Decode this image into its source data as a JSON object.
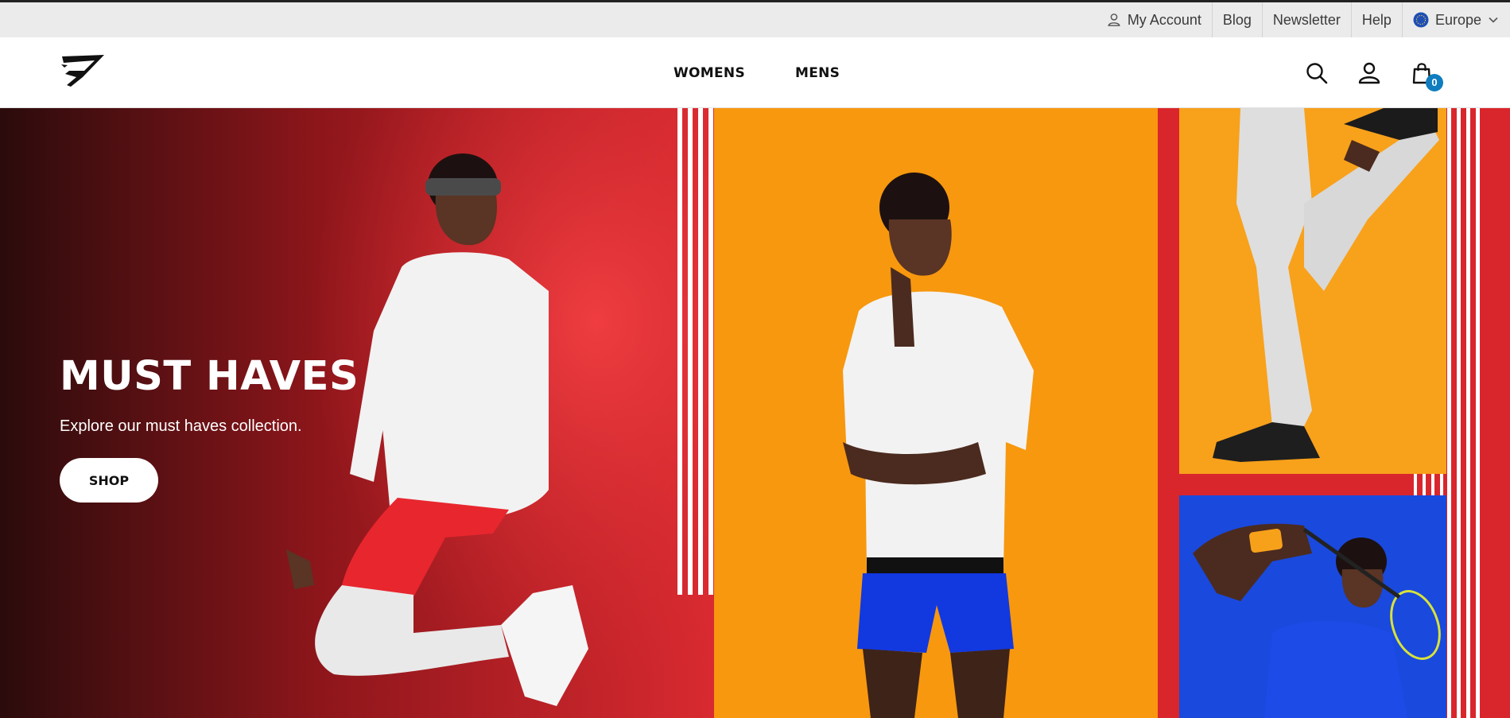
{
  "utility_bar": {
    "my_account": "My Account",
    "blog": "Blog",
    "newsletter": "Newsletter",
    "help": "Help",
    "region": "Europe"
  },
  "header": {
    "nav": [
      "WOMENS",
      "MENS"
    ],
    "cart_count": "0",
    "icons": [
      "search-icon",
      "user-icon",
      "shopping-bag-icon"
    ]
  },
  "hero": {
    "title": "MUST HAVES",
    "subtitle": "Explore our must haves collection.",
    "cta": "SHOP"
  },
  "colors": {
    "hero_red": "#e0282e",
    "hero_orange": "#f7980f",
    "hero_blue": "#1a49dd",
    "badge_blue": "#0f7dbf",
    "utility_bg": "#ebebeb"
  }
}
